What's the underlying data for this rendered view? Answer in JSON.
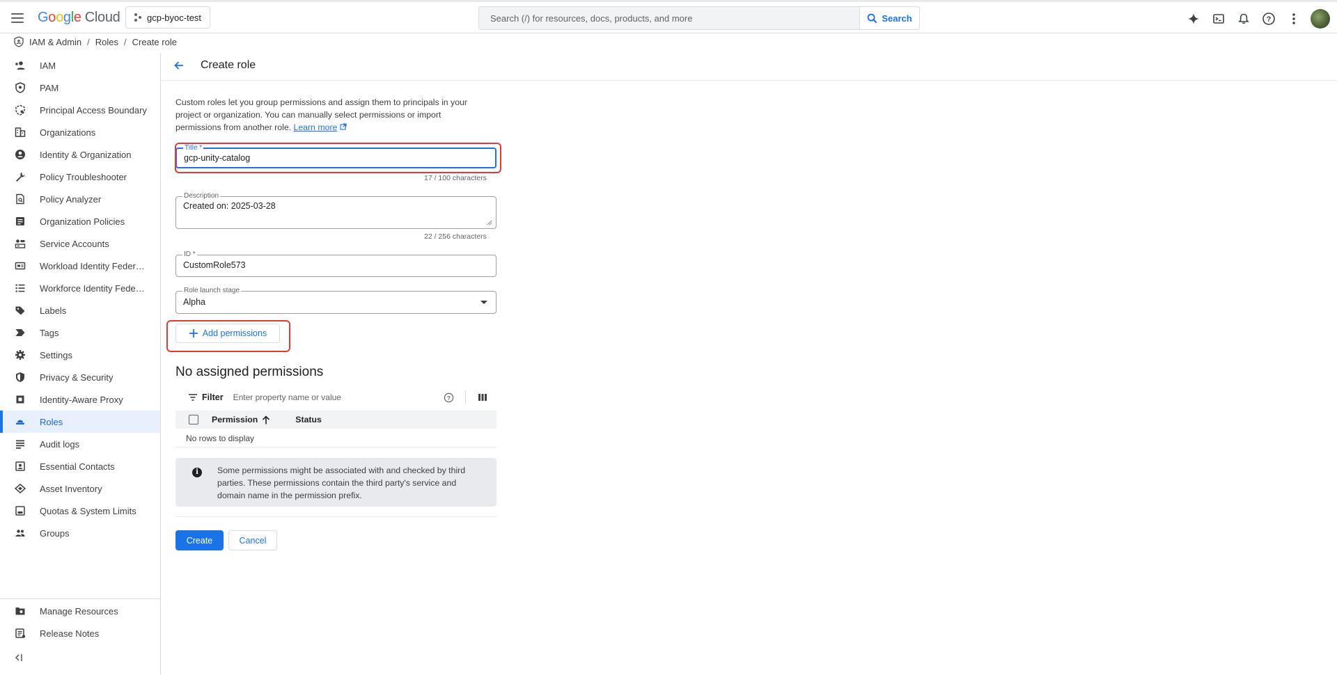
{
  "header": {
    "logo_google": [
      "G",
      "o",
      "o",
      "g",
      "l",
      "e"
    ],
    "logo_cloud": "Cloud",
    "project": "gcp-byoc-test",
    "search_placeholder": "Search (/) for resources, docs, products, and more",
    "search_button": "Search"
  },
  "breadcrumb": {
    "items": [
      "IAM & Admin",
      "Roles",
      "Create role"
    ],
    "separator": "/"
  },
  "sidebar": {
    "items": [
      {
        "label": "IAM",
        "icon": "person-add-icon"
      },
      {
        "label": "PAM",
        "icon": "shield-icon"
      },
      {
        "label": "Principal Access Boundary",
        "icon": "boundary-icon"
      },
      {
        "label": "Organizations",
        "icon": "organization-icon"
      },
      {
        "label": "Identity & Organization",
        "icon": "account-circle-icon"
      },
      {
        "label": "Policy Troubleshooter",
        "icon": "wrench-icon"
      },
      {
        "label": "Policy Analyzer",
        "icon": "document-search-icon"
      },
      {
        "label": "Organization Policies",
        "icon": "policy-icon"
      },
      {
        "label": "Service Accounts",
        "icon": "service-account-icon"
      },
      {
        "label": "Workload Identity Federat...",
        "icon": "id-card-icon"
      },
      {
        "label": "Workforce Identity Federa...",
        "icon": "list-icon"
      },
      {
        "label": "Labels",
        "icon": "label-icon"
      },
      {
        "label": "Tags",
        "icon": "tag-icon"
      },
      {
        "label": "Settings",
        "icon": "gear-icon"
      },
      {
        "label": "Privacy & Security",
        "icon": "security-shield-icon"
      },
      {
        "label": "Identity-Aware Proxy",
        "icon": "proxy-icon"
      },
      {
        "label": "Roles",
        "icon": "roles-icon",
        "active": true
      },
      {
        "label": "Audit logs",
        "icon": "audit-logs-icon"
      },
      {
        "label": "Essential Contacts",
        "icon": "contacts-icon"
      },
      {
        "label": "Asset Inventory",
        "icon": "inventory-icon"
      },
      {
        "label": "Quotas & System Limits",
        "icon": "quotas-icon"
      },
      {
        "label": "Groups",
        "icon": "groups-icon"
      }
    ],
    "bottom_items": [
      {
        "label": "Manage Resources",
        "icon": "folder-settings-icon"
      },
      {
        "label": "Release Notes",
        "icon": "release-notes-icon"
      }
    ],
    "collapse_label": "<|"
  },
  "page": {
    "title": "Create role",
    "intro_text": "Custom roles let you group permissions and assign them to principals in your project or organization. You can manually select permissions or import permissions from another role.",
    "learn_more": "Learn more",
    "title_field": {
      "label": "Title *",
      "value": "gcp-unity-catalog",
      "counter": "17 / 100 characters"
    },
    "description_field": {
      "label": "Description",
      "value": "Created on: 2025-03-28",
      "counter": "22 / 256 characters"
    },
    "id_field": {
      "label": "ID *",
      "value": "CustomRole573"
    },
    "launch_stage": {
      "label": "Role launch stage",
      "value": "Alpha"
    },
    "add_permissions": "Add permissions",
    "permissions_heading": "No assigned permissions",
    "filter": {
      "label": "Filter",
      "placeholder": "Enter property name or value"
    },
    "table": {
      "columns": [
        "Permission",
        "Status"
      ],
      "empty": "No rows to display"
    },
    "info": "Some permissions might be associated with and checked by third parties. These permissions contain the third party's service and domain name in the permission prefix.",
    "create_button": "Create",
    "cancel_button": "Cancel"
  },
  "colors": {
    "accent": "#1a73e8",
    "highlight": "#e53935",
    "active_bg": "#e8f0fe"
  }
}
